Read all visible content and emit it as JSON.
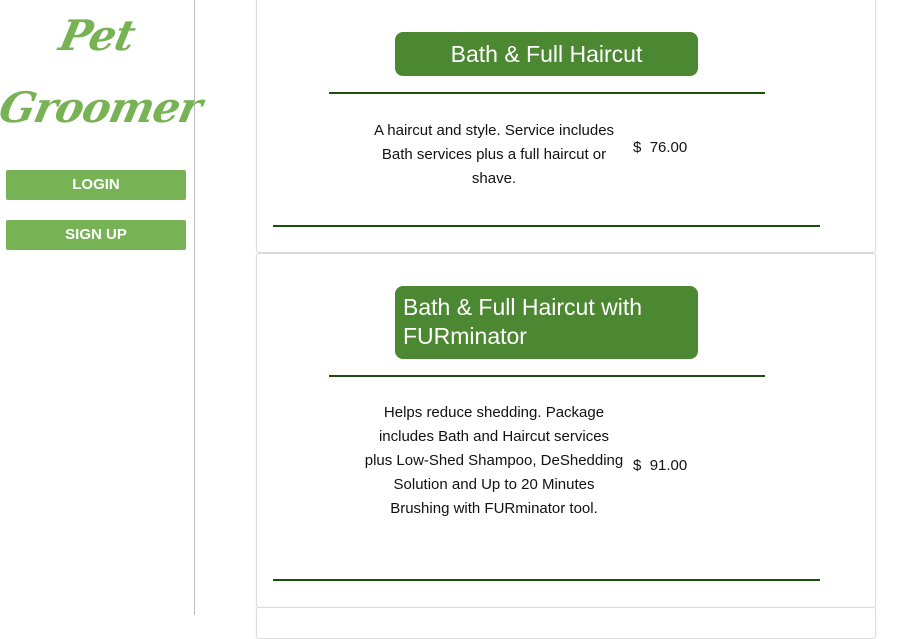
{
  "sidebar": {
    "logo_line1": "Pet",
    "logo_line2": "Groomer",
    "login_label": "LOGIN",
    "signup_label": "SIGN UP",
    "accent_color": "#77b255"
  },
  "services": [
    {
      "title": "Bath & Full Haircut",
      "description": "A haircut and style. Service includes Bath services plus a full haircut or shave.",
      "currency": "$",
      "price": "76.00"
    },
    {
      "title": "Bath & Full Haircut with FURminator",
      "description": "Helps reduce shedding. Package includes Bath and Haircut services plus Low-Shed Shampoo, DeShedding Solution and Up to 20 Minutes Brushing with FURminator tool.",
      "currency": "$",
      "price": "91.00"
    }
  ],
  "colors": {
    "title_pill": "#4c8731",
    "rule": "#1e4d10"
  }
}
